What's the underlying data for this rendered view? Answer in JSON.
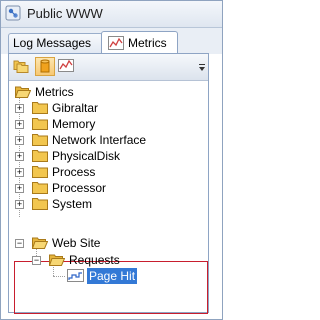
{
  "window": {
    "title": "Public WWW",
    "icon": "application-icon"
  },
  "tabs": [
    {
      "label": "Log Messages",
      "selected": false
    },
    {
      "label": "Metrics",
      "selected": true,
      "icon": "chart-icon"
    }
  ],
  "toolbar": {
    "buttons": [
      {
        "icon": "folders-icon",
        "pressed": false
      },
      {
        "icon": "cylinder-icon",
        "pressed": true
      },
      {
        "icon": "chart-icon",
        "pressed": false
      }
    ],
    "dropdown_icon": "dropdown-arrow-icon"
  },
  "tree": {
    "root": {
      "label": "Metrics",
      "expanded": true
    },
    "items": [
      {
        "label": "Gibraltar",
        "expanded": false
      },
      {
        "label": "Memory",
        "expanded": false
      },
      {
        "label": "Network Interface",
        "expanded": false
      },
      {
        "label": "PhysicalDisk",
        "expanded": false
      },
      {
        "label": "Process",
        "expanded": false
      },
      {
        "label": "Processor",
        "expanded": false
      },
      {
        "label": "System",
        "expanded": false
      },
      {
        "label": "Web Site",
        "expanded": true
      }
    ],
    "web_site_child": {
      "label": "Requests",
      "expanded": true
    },
    "requests_child": {
      "label": "Page Hit",
      "selected": true
    }
  },
  "colors": {
    "highlight_border": "#c81e2e",
    "selection": "#3379d6",
    "folder": "#f2c64f"
  }
}
